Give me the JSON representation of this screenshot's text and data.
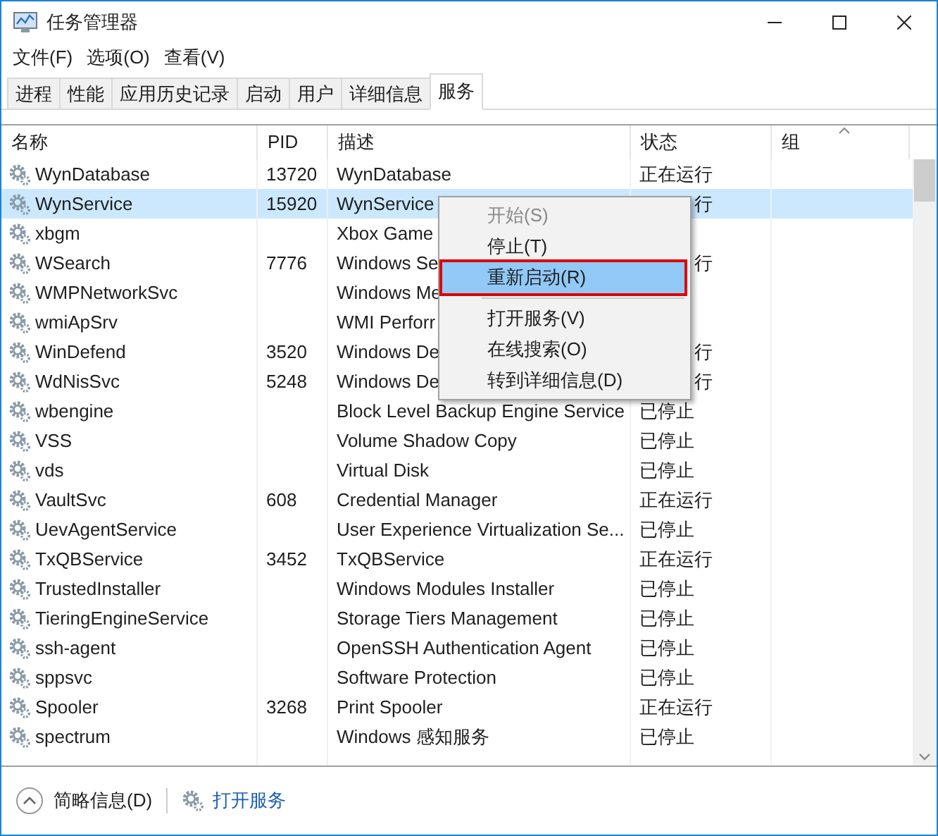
{
  "window": {
    "title": "任务管理器"
  },
  "menu": [
    "文件(F)",
    "选项(O)",
    "查看(V)"
  ],
  "tabs": [
    {
      "label": "进程",
      "selected": false
    },
    {
      "label": "性能",
      "selected": false
    },
    {
      "label": "应用历史记录",
      "selected": false
    },
    {
      "label": "启动",
      "selected": false
    },
    {
      "label": "用户",
      "selected": false
    },
    {
      "label": "详细信息",
      "selected": false
    },
    {
      "label": "服务",
      "selected": true
    }
  ],
  "table": {
    "columns": [
      "名称",
      "PID",
      "描述",
      "状态",
      "组"
    ],
    "rows": [
      {
        "name": "WynDatabase",
        "pid": "13720",
        "description": "WynDatabase",
        "status": "正在运行",
        "selected": false
      },
      {
        "name": "WynService",
        "pid": "15920",
        "description": "WynService",
        "status": "行",
        "status_cut": true,
        "selected": true
      },
      {
        "name": "xbgm",
        "description": "Xbox Game",
        "selected": false
      },
      {
        "name": "WSearch",
        "pid": "7776",
        "description": "Windows Se",
        "status": "行",
        "status_cut": true,
        "selected": false
      },
      {
        "name": "WMPNetworkSvc",
        "description": "Windows Me",
        "selected": false
      },
      {
        "name": "wmiApSrv",
        "description": "WMI Perforr",
        "selected": false
      },
      {
        "name": "WinDefend",
        "pid": "3520",
        "description": "Windows De",
        "status": "行",
        "status_cut": true,
        "selected": false
      },
      {
        "name": "WdNisSvc",
        "pid": "5248",
        "description": "Windows De",
        "status": "行",
        "status_cut": true,
        "selected": false
      },
      {
        "name": "wbengine",
        "description": "Block Level Backup Engine Service",
        "status": "已停止",
        "selected": false
      },
      {
        "name": "VSS",
        "description": "Volume Shadow Copy",
        "status": "已停止",
        "selected": false
      },
      {
        "name": "vds",
        "description": "Virtual Disk",
        "status": "已停止",
        "selected": false
      },
      {
        "name": "VaultSvc",
        "pid": "608",
        "description": "Credential Manager",
        "status": "正在运行",
        "selected": false
      },
      {
        "name": "UevAgentService",
        "description": "User Experience Virtualization Se...",
        "status": "已停止",
        "selected": false
      },
      {
        "name": "TxQBService",
        "pid": "3452",
        "description": "TxQBService",
        "status": "正在运行",
        "selected": false
      },
      {
        "name": "TrustedInstaller",
        "description": "Windows Modules Installer",
        "status": "已停止",
        "selected": false
      },
      {
        "name": "TieringEngineService",
        "description": "Storage Tiers Management",
        "status": "已停止",
        "selected": false
      },
      {
        "name": "ssh-agent",
        "description": "OpenSSH Authentication Agent",
        "status": "已停止",
        "selected": false
      },
      {
        "name": "sppsvc",
        "description": "Software Protection",
        "status": "已停止",
        "selected": false
      },
      {
        "name": "Spooler",
        "pid": "3268",
        "description": "Print Spooler",
        "status": "正在运行",
        "selected": false
      },
      {
        "name": "spectrum",
        "description": "Windows 感知服务",
        "status": "已停止",
        "selected": false
      }
    ]
  },
  "context_menu": [
    {
      "kind": "item",
      "label": "开始(S)",
      "disabled": true,
      "highlighted": false
    },
    {
      "kind": "item",
      "label": "停止(T)",
      "disabled": false,
      "highlighted": false
    },
    {
      "kind": "item",
      "label": "重新启动(R)",
      "disabled": false,
      "highlighted": true
    },
    {
      "kind": "separator"
    },
    {
      "kind": "item",
      "label": "打开服务(V)",
      "disabled": false,
      "highlighted": false
    },
    {
      "kind": "item",
      "label": "在线搜索(O)",
      "disabled": false,
      "highlighted": false
    },
    {
      "kind": "item",
      "label": "转到详细信息(D)",
      "disabled": false,
      "highlighted": false
    }
  ],
  "footer": {
    "details_toggle": "简略信息(D)",
    "open_services": "打开服务"
  }
}
